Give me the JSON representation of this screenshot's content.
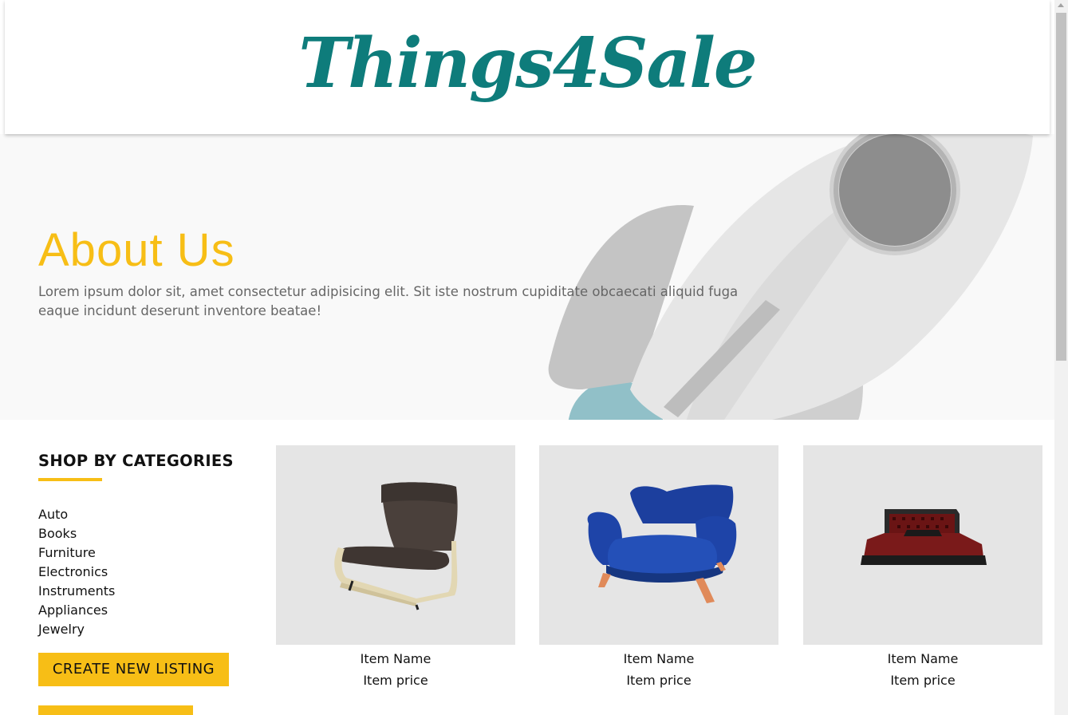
{
  "brand": {
    "logo_text": "Things4Sale",
    "accent_color": "#f7be16",
    "logo_color": "#0e7c7b"
  },
  "hero": {
    "title": "About Us",
    "text": "Lorem ipsum dolor sit, amet consectetur adipisicing elit. Sit iste nostrum cupiditate obcaecati aliquid fuga eaque incidunt deserunt inventore beatae!",
    "illustration": "rocket-illustration"
  },
  "sidebar": {
    "heading": "SHOP BY CATEGORIES",
    "categories": [
      "Auto",
      "Books",
      "Furniture",
      "Electronics",
      "Instruments",
      "Appliances",
      "Jewelry"
    ],
    "create_button": "CREATE NEW LISTING"
  },
  "products": [
    {
      "name": "Item Name",
      "price": "Item price",
      "image": "armchair-image"
    },
    {
      "name": "Item Name",
      "price": "Item price",
      "image": "blue-sofa-chair-image"
    },
    {
      "name": "Item Name",
      "price": "Item price",
      "image": "bed-image"
    }
  ]
}
